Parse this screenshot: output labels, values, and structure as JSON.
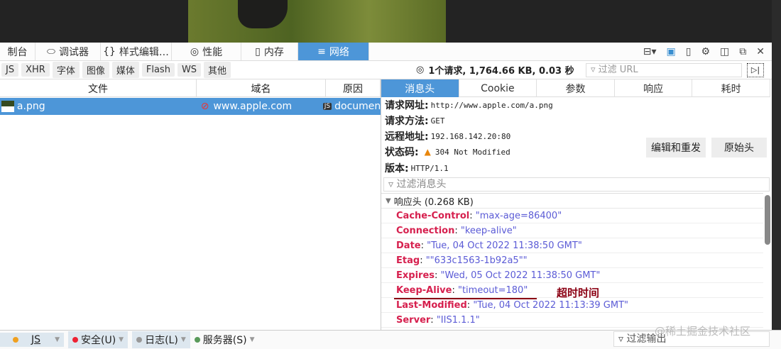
{
  "tabs": [
    {
      "label": "制台"
    },
    {
      "label": "调试器"
    },
    {
      "label": "样式编辑…"
    },
    {
      "label": "性能"
    },
    {
      "label": "内存"
    },
    {
      "label": "网络"
    }
  ],
  "filters": [
    "JS",
    "XHR",
    "字体",
    "图像",
    "媒体",
    "Flash",
    "WS",
    "其他"
  ],
  "stats": "1个请求, 1,764.66 KB, 0.03 秒",
  "url_filter_placeholder": "过滤 URL",
  "columns": [
    "文件",
    "域名",
    "原因"
  ],
  "request": {
    "file": "a.png",
    "domain": "www.apple.com",
    "cause": "documen"
  },
  "detail_tabs": [
    "消息头",
    "Cookie",
    "参数",
    "响应",
    "耗时"
  ],
  "info": [
    {
      "label": "请求网址:",
      "value": "http://www.apple.com/a.png"
    },
    {
      "label": "请求方法:",
      "value": "GET"
    },
    {
      "label": "远程地址:",
      "value": "192.168.142.20:80"
    },
    {
      "label": "状态码:",
      "value": "304 Not Modified"
    },
    {
      "label": "版本:",
      "value": "HTTP/1.1"
    }
  ],
  "buttons": {
    "edit_resend": "编辑和重发",
    "raw_headers": "原始头"
  },
  "header_filter_placeholder": "过滤消息头",
  "response_headers_title": "响应头 (0.268 KB)",
  "headers": [
    {
      "k": "Cache-Control",
      "v": "\"max-age=86400\""
    },
    {
      "k": "Connection",
      "v": "\"keep-alive\""
    },
    {
      "k": "Date",
      "v": "\"Tue, 04 Oct 2022 11:38:50 GMT\""
    },
    {
      "k": "Etag",
      "v": "\"\"633c1563-1b92a5\"\""
    },
    {
      "k": "Expires",
      "v": "\"Wed, 05 Oct 2022 11:38:50 GMT\""
    },
    {
      "k": "Keep-Alive",
      "v": "\"timeout=180\""
    },
    {
      "k": "Last-Modified",
      "v": "\"Tue, 04 Oct 2022 11:13:39 GMT\""
    },
    {
      "k": "Server",
      "v": "\"IIS1.1.1\""
    }
  ],
  "annotation": "超时时间",
  "console": {
    "js": "JS",
    "security": "安全(U)",
    "log": "日志(L)",
    "server": "服务器(S)",
    "filter": "过滤输出"
  },
  "watermark": "@稀土掘金技术社区"
}
